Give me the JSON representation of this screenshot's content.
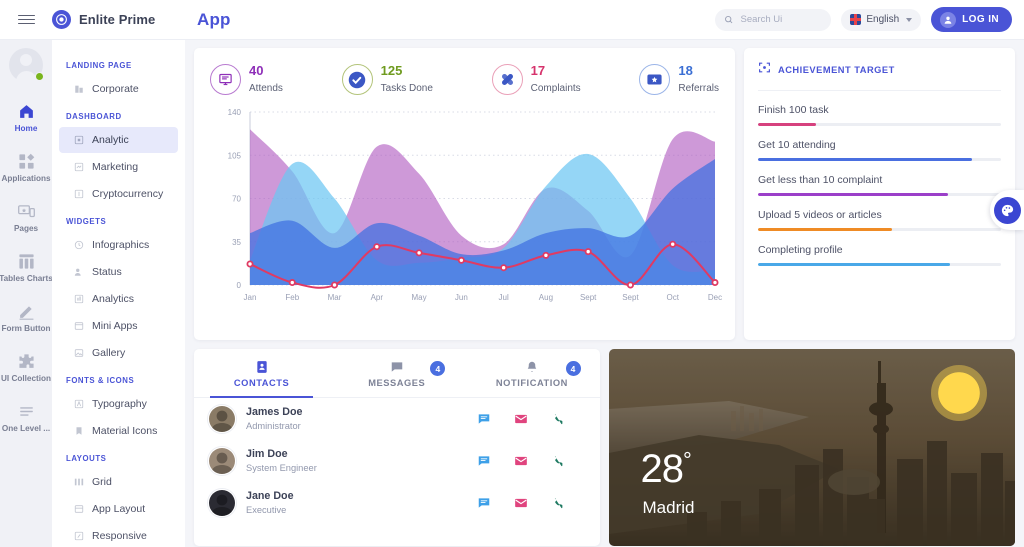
{
  "header": {
    "menu_icon": "hamburger-icon",
    "brand": "Enlite Prime",
    "app_title": "App",
    "search_placeholder": "Search Ui",
    "search_value": "",
    "language": "English",
    "login_label": "LOG IN"
  },
  "rail": {
    "items": [
      {
        "label": "Home",
        "icon": "home-icon",
        "active": true
      },
      {
        "label": "Applications",
        "icon": "apps-icon",
        "active": false
      },
      {
        "label": "Pages",
        "icon": "pages-icon",
        "active": false
      },
      {
        "label": "Tables Charts",
        "icon": "tables-charts-icon",
        "active": false
      },
      {
        "label": "Form Button",
        "icon": "pencil-icon",
        "active": false
      },
      {
        "label": "UI Collection",
        "icon": "puzzle-icon",
        "active": false
      },
      {
        "label": "One Level ...",
        "icon": "list-icon",
        "active": false
      }
    ]
  },
  "sidebar": {
    "groups": [
      {
        "title": "LANDING PAGE",
        "items": [
          {
            "label": "Corporate",
            "icon": "building-icon",
            "active": false
          }
        ]
      },
      {
        "title": "DASHBOARD",
        "items": [
          {
            "label": "Analytic",
            "icon": "analytic-icon",
            "active": true
          },
          {
            "label": "Marketing",
            "icon": "marketing-icon",
            "active": false
          },
          {
            "label": "Cryptocurrency",
            "icon": "crypto-icon",
            "active": false
          }
        ]
      },
      {
        "title": "WIDGETS",
        "items": [
          {
            "label": "Infographics",
            "icon": "infographics-icon",
            "active": false
          },
          {
            "label": "Status",
            "icon": "status-icon",
            "active": false
          },
          {
            "label": "Analytics",
            "icon": "analytics-icon",
            "active": false
          },
          {
            "label": "Mini Apps",
            "icon": "mini-apps-icon",
            "active": false
          },
          {
            "label": "Gallery",
            "icon": "gallery-icon",
            "active": false
          }
        ]
      },
      {
        "title": "FONTS & ICONS",
        "items": [
          {
            "label": "Typography",
            "icon": "typography-icon",
            "active": false
          },
          {
            "label": "Material Icons",
            "icon": "material-icons-icon",
            "active": false
          }
        ]
      },
      {
        "title": "LAYOUTS",
        "items": [
          {
            "label": "Grid",
            "icon": "grid-icon",
            "active": false
          },
          {
            "label": "App Layout",
            "icon": "app-layout-icon",
            "active": false
          },
          {
            "label": "Responsive",
            "icon": "responsive-icon",
            "active": false
          }
        ]
      }
    ]
  },
  "stats": [
    {
      "value": "40",
      "label": "Attends",
      "icon": "monitor-icon",
      "color": "#8e2fb8",
      "ring": "#b87ad0"
    },
    {
      "value": "125",
      "label": "Tasks Done",
      "icon": "check-icon",
      "color": "#6f9b1f",
      "ring": "#b3c47a"
    },
    {
      "value": "17",
      "label": "Complaints",
      "icon": "bandage-icon",
      "color": "#d6336c",
      "ring": "#eaa0b8"
    },
    {
      "value": "18",
      "label": "Referrals",
      "icon": "ticket-icon",
      "color": "#3b6fd4",
      "ring": "#9bb5e8"
    }
  ],
  "chart_data": {
    "type": "area",
    "title": "",
    "xlabel": "",
    "ylabel": "",
    "categories": [
      "Jan",
      "Feb",
      "Mar",
      "Apr",
      "May",
      "Jun",
      "Jul",
      "Aug",
      "Sept",
      "Sept",
      "Oct",
      "Dec"
    ],
    "yticks": [
      0,
      35,
      70,
      105,
      140
    ],
    "ylim": [
      0,
      140
    ],
    "grid": true,
    "legend": "none",
    "series": [
      {
        "name": "purple-area",
        "color": "#b05ac0",
        "fill_opacity": 0.62,
        "values": [
          126,
          92,
          42,
          112,
          90,
          40,
          33,
          78,
          60,
          24,
          118,
          116
        ]
      },
      {
        "name": "lightblue-area",
        "color": "#6cc6f2",
        "fill_opacity": 0.72,
        "values": [
          20,
          98,
          70,
          20,
          18,
          22,
          30,
          80,
          106,
          70,
          16,
          12
        ]
      },
      {
        "name": "blue-area",
        "color": "#3f6fe0",
        "fill_opacity": 0.72,
        "values": [
          42,
          52,
          30,
          50,
          40,
          25,
          28,
          42,
          46,
          40,
          78,
          102
        ]
      },
      {
        "name": "crimson-line",
        "color": "#e03a63",
        "type": "line",
        "values": [
          17,
          2,
          0,
          31,
          26,
          20,
          14,
          24,
          27,
          0,
          33,
          2
        ]
      }
    ]
  },
  "achievement": {
    "title": "ACHIEVEMENT TARGET",
    "icon": "target-icon",
    "goals": [
      {
        "label": "Finish 100 task",
        "percent": 24,
        "color": "#d6417e"
      },
      {
        "label": "Get 10 attending",
        "percent": 88,
        "color": "#4a6fe0"
      },
      {
        "label": "Get less than 10 complaint",
        "percent": 78,
        "color": "#9b3fc9"
      },
      {
        "label": "Upload 5 videos or articles",
        "percent": 55,
        "color": "#ef8b25"
      },
      {
        "label": "Completing profile",
        "percent": 79,
        "color": "#49a8e8"
      }
    ]
  },
  "contacts_panel": {
    "tabs": [
      {
        "label": "CONTACTS",
        "icon": "contact-card-icon",
        "badge": "",
        "active": true
      },
      {
        "label": "MESSAGES",
        "icon": "message-icon",
        "badge": "4",
        "active": false
      },
      {
        "label": "NOTIFICATION",
        "icon": "bell-icon",
        "badge": "4",
        "active": false
      }
    ],
    "contacts": [
      {
        "name": "James Doe",
        "role": "Administrator",
        "avatar": "#8a7b66"
      },
      {
        "name": "Jim Doe",
        "role": "System Engineer",
        "avatar": "#9b8a78"
      },
      {
        "name": "Jane Doe",
        "role": "Executive",
        "avatar": "#2b2b33"
      }
    ],
    "actions": [
      {
        "icon": "chat-icon",
        "color": "#3ea0e8"
      },
      {
        "icon": "mail-icon",
        "color": "#e0447e"
      },
      {
        "icon": "phone-icon",
        "color": "#1f7a62"
      }
    ]
  },
  "weather": {
    "temperature": "28",
    "degree_symbol": "°",
    "city": "Madrid",
    "icon": "sun-icon"
  },
  "fab": {
    "icon": "palette-icon",
    "color": "#3b46d2"
  }
}
